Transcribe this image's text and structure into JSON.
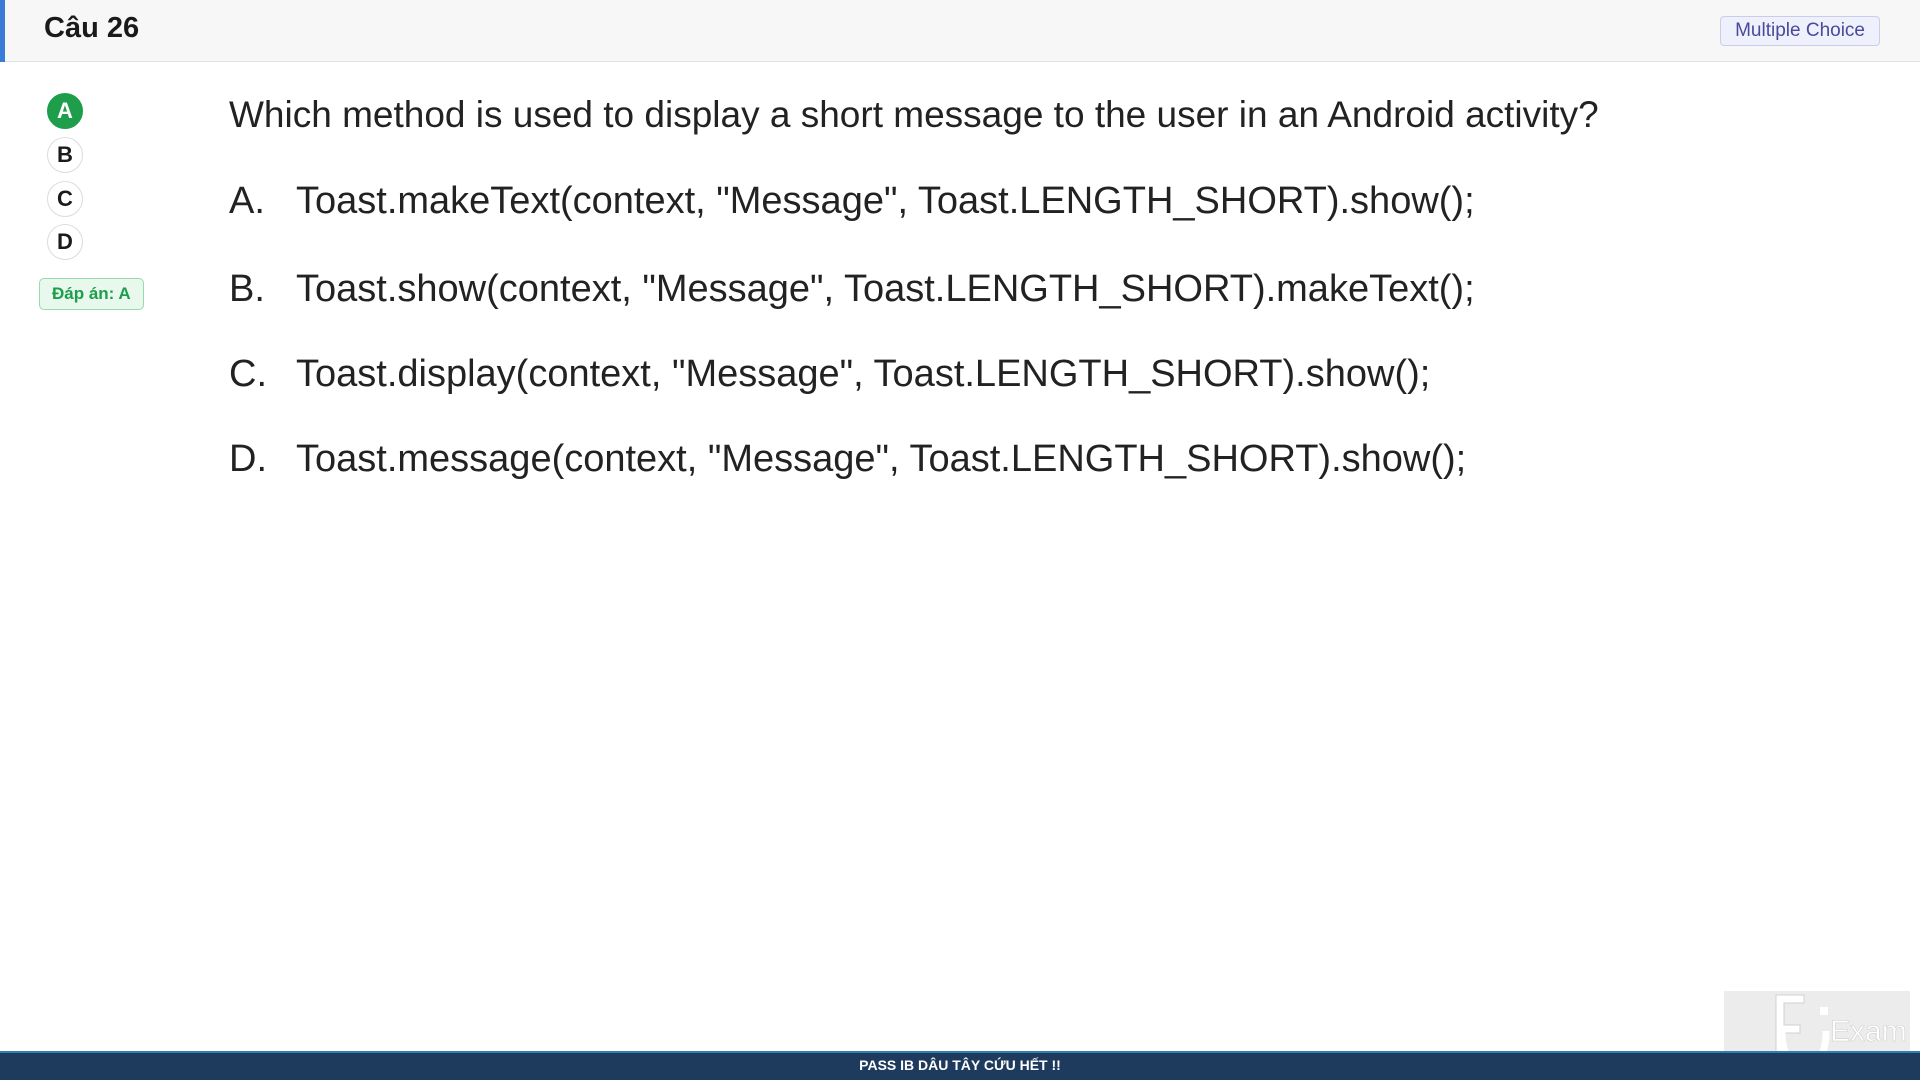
{
  "header": {
    "title": "Câu 26",
    "type_badge": "Multiple Choice"
  },
  "answer_selector": {
    "choices": [
      "A",
      "B",
      "C",
      "D"
    ],
    "selected": "A",
    "answer_key": "Đáp án: A"
  },
  "question": {
    "stem": "Which method is used to display a short message to the user in an Android activity?",
    "options": [
      {
        "letter": "A.",
        "text": "Toast.makeText(context, \"Message\", Toast.LENGTH_SHORT).show();"
      },
      {
        "letter": "B.",
        "text": "Toast.show(context, \"Message\", Toast.LENGTH_SHORT).makeText();"
      },
      {
        "letter": "C.",
        "text": "Toast.display(context, \"Message\", Toast.LENGTH_SHORT).show();"
      },
      {
        "letter": "D.",
        "text": "Toast.message(context, \"Message\", Toast.LENGTH_SHORT).show();"
      }
    ]
  },
  "logo": {
    "text": "FU Exam"
  },
  "footer": {
    "text": "PASS IB DÂU TÂY CỨU HẾT !!"
  },
  "colors": {
    "accent": "#3a7bd5",
    "correct": "#1e9e4a",
    "footer_bg": "#1e3a5c"
  }
}
